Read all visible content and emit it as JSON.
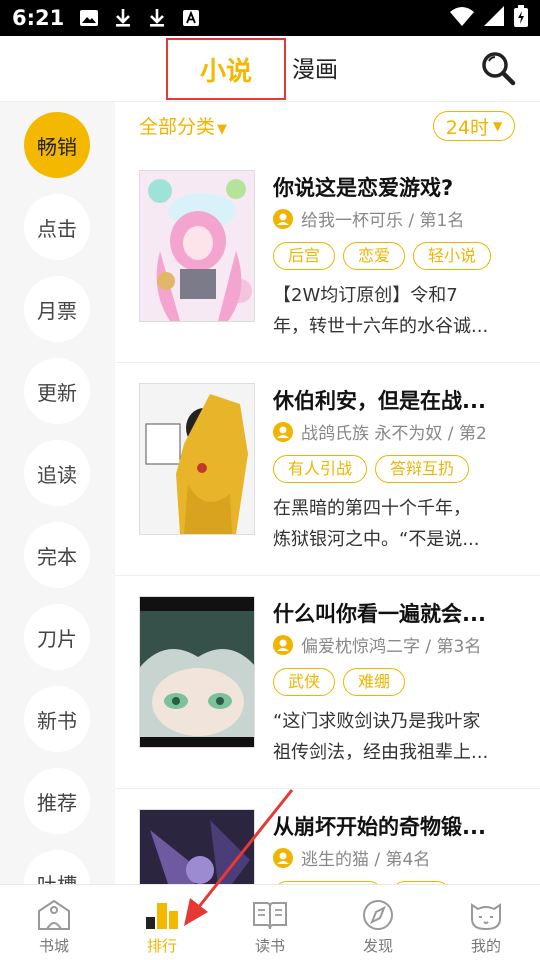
{
  "status_bar": {
    "time": "6:21"
  },
  "header": {
    "tab_novel": "小说",
    "tab_comic": "漫画"
  },
  "sidebar": {
    "items": [
      {
        "label": "畅销",
        "active": true
      },
      {
        "label": "点击"
      },
      {
        "label": "月票"
      },
      {
        "label": "更新"
      },
      {
        "label": "追读"
      },
      {
        "label": "完本"
      },
      {
        "label": "刀片"
      },
      {
        "label": "新书"
      },
      {
        "label": "推荐"
      },
      {
        "label": "吐槽"
      }
    ]
  },
  "filter": {
    "category": "全部分类",
    "time": "24时"
  },
  "books": [
    {
      "title": "你说这是恋爱游戏?",
      "meta": "给我一杯可乐 / 第1名",
      "tags": [
        "后宫",
        "恋爱",
        "轻小说"
      ],
      "desc": [
        "【2W均订原创】令和7",
        "年，转世十六年的水谷诚..."
      ]
    },
    {
      "title": "休伯利安，但是在战...",
      "meta": "战鸽氏族 永不为奴 / 第2",
      "tags": [
        "有人引战",
        "答辩互扔"
      ],
      "desc": [
        "在黑暗的第四十个千年，",
        "炼狱银河之中。“不是说..."
      ]
    },
    {
      "title": "什么叫你看一遍就会...",
      "meta": "偏爱枕惊鸿二字 / 第3名",
      "tags": [
        "武侠",
        "难绷"
      ],
      "desc": [
        "“这门求败剑诀乃是我叶家",
        "祖传剑法，经由我祖辈上..."
      ]
    },
    {
      "title": "从崩坏开始的奇物锻...",
      "meta": "逃生的猫 / 第4名",
      "tags": [
        "",
        ""
      ],
      "desc": [
        "",
        ""
      ]
    }
  ],
  "bottom_nav": [
    {
      "label": "书城"
    },
    {
      "label": "排行",
      "active": true
    },
    {
      "label": "读书"
    },
    {
      "label": "发现"
    },
    {
      "label": "我的"
    }
  ],
  "colors": {
    "accent": "#f5b800",
    "annotation": "#e53935"
  }
}
